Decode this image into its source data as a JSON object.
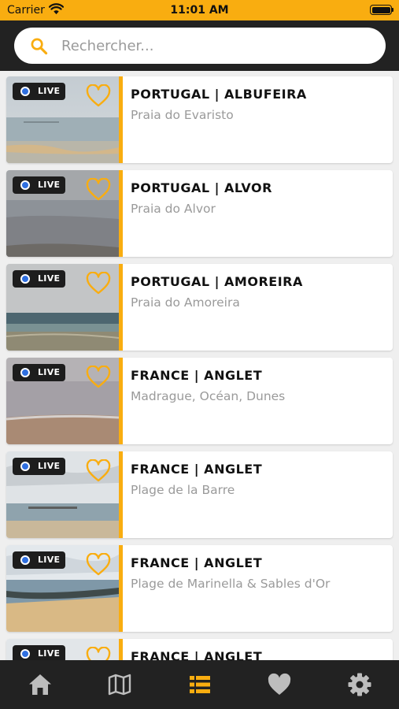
{
  "status_bar": {
    "carrier": "Carrier",
    "time": "11:01 AM"
  },
  "search": {
    "placeholder": "Rechercher..."
  },
  "colors": {
    "accent": "#f9ad10",
    "header": "#222222",
    "nav_inactive": "#bdbdbd",
    "live_dot": "#2f6fe0"
  },
  "webcams": [
    {
      "live": "LIVE",
      "title": "PORTUGAL | ALBUFEIRA",
      "subtitle": "Praia do Evaristo",
      "favorite": false
    },
    {
      "live": "LIVE",
      "title": "PORTUGAL | ALVOR",
      "subtitle": "Praia do Alvor",
      "favorite": false
    },
    {
      "live": "LIVE",
      "title": "PORTUGAL | AMOREIRA",
      "subtitle": "Praia do Amoreira",
      "favorite": false
    },
    {
      "live": "LIVE",
      "title": "FRANCE | ANGLET",
      "subtitle": "Madrague, Océan, Dunes",
      "favorite": false
    },
    {
      "live": "LIVE",
      "title": "FRANCE | ANGLET",
      "subtitle": "Plage de la Barre",
      "favorite": false
    },
    {
      "live": "LIVE",
      "title": "FRANCE | ANGLET",
      "subtitle": "Plage de Marinella & Sables d'Or",
      "favorite": false
    },
    {
      "live": "LIVE",
      "title": "FRANCE | ANGLET",
      "subtitle": "",
      "favorite": false
    }
  ],
  "bottom_nav": [
    {
      "icon": "home-icon",
      "active": false
    },
    {
      "icon": "map-icon",
      "active": false
    },
    {
      "icon": "list-icon",
      "active": true
    },
    {
      "icon": "heart-icon",
      "active": false
    },
    {
      "icon": "gear-icon",
      "active": false
    }
  ]
}
